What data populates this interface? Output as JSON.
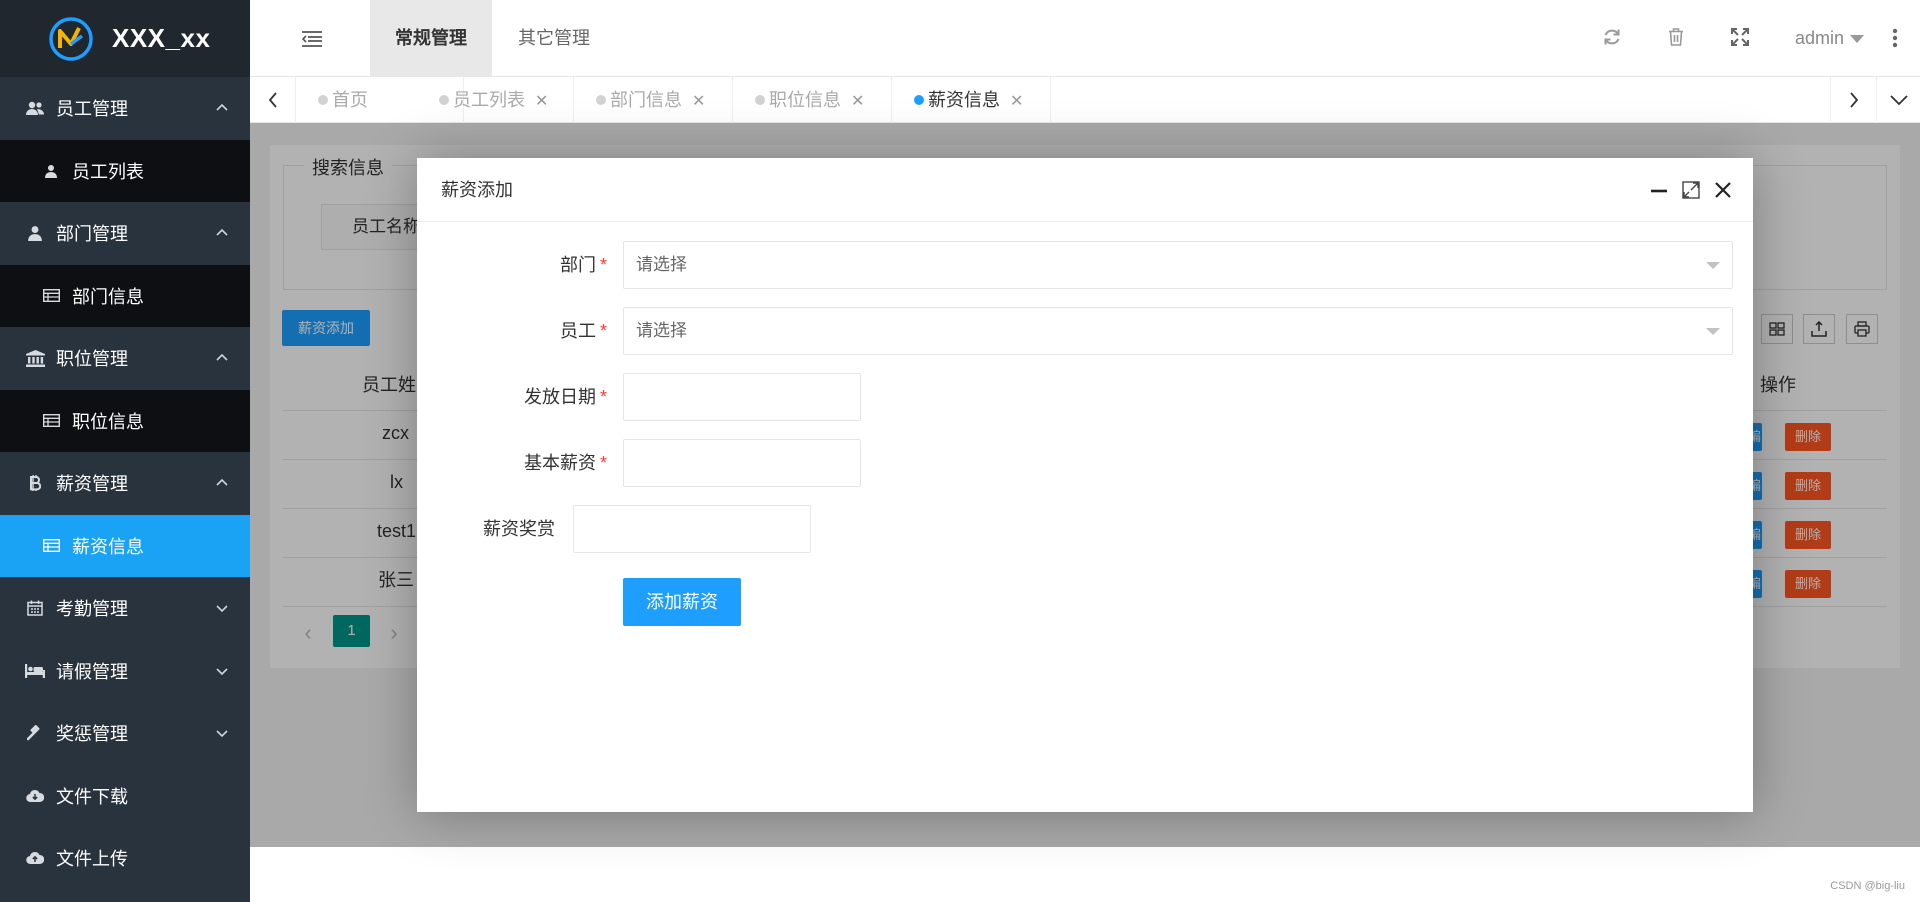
{
  "brand": {
    "title": "XXX_xx"
  },
  "sidebar": {
    "items": [
      {
        "label": "员工管理",
        "icon": "users-icon",
        "expanded": true,
        "children": [
          {
            "label": "员工列表",
            "icon": "user-icon"
          }
        ]
      },
      {
        "label": "部门管理",
        "icon": "user-icon",
        "expanded": true,
        "children": [
          {
            "label": "部门信息",
            "icon": "table-icon"
          }
        ]
      },
      {
        "label": "职位管理",
        "icon": "bank-icon",
        "expanded": true,
        "children": [
          {
            "label": "职位信息",
            "icon": "table-icon"
          }
        ]
      },
      {
        "label": "薪资管理",
        "icon": "bitcoin-icon",
        "expanded": true,
        "children": [
          {
            "label": "薪资信息",
            "icon": "table-icon",
            "active": true
          }
        ]
      },
      {
        "label": "考勤管理",
        "icon": "calendar-icon",
        "expanded": false
      },
      {
        "label": "请假管理",
        "icon": "bed-icon",
        "expanded": false
      },
      {
        "label": "奖惩管理",
        "icon": "gavel-icon",
        "expanded": false
      },
      {
        "label": "文件下载",
        "icon": "cloud-download-icon"
      },
      {
        "label": "文件上传",
        "icon": "cloud-upload-icon"
      }
    ]
  },
  "header": {
    "tabs": [
      {
        "label": "常规管理",
        "active": true
      },
      {
        "label": "其它管理",
        "active": false
      }
    ],
    "user": "admin"
  },
  "page_tabs": [
    {
      "label": "首页",
      "closable": false,
      "active": false
    },
    {
      "label": "员工列表",
      "closable": true,
      "active": false
    },
    {
      "label": "部门信息",
      "closable": true,
      "active": false
    },
    {
      "label": "职位信息",
      "closable": true,
      "active": false
    },
    {
      "label": "薪资信息",
      "closable": true,
      "active": true
    }
  ],
  "background_page": {
    "search_legend": "搜索信息",
    "search_label": "员工名称",
    "add_button": "薪资添加",
    "columns": {
      "name": "员工姓名",
      "actions": "操作"
    },
    "rows": [
      {
        "name": "zcx"
      },
      {
        "name": "lx"
      },
      {
        "name": "test1"
      },
      {
        "name": "张三"
      }
    ],
    "delete_label": "删除",
    "edit_label": "编辑",
    "current_page": "1"
  },
  "modal": {
    "title": "薪资添加",
    "fields": {
      "department": {
        "label": "部门",
        "required": true,
        "placeholder": "请选择"
      },
      "employee": {
        "label": "员工",
        "required": true,
        "placeholder": "请选择"
      },
      "date": {
        "label": "发放日期",
        "required": true,
        "value": ""
      },
      "base_salary": {
        "label": "基本薪资",
        "required": true,
        "value": ""
      },
      "bonus": {
        "label": "薪资奖赏",
        "required": false,
        "value": ""
      }
    },
    "submit_label": "添加薪资"
  },
  "watermark": "CSDN @big-liu",
  "colors": {
    "sidebar": "#28333e",
    "accent": "#1e9fff",
    "danger": "#ff5722",
    "pager": "#009688"
  }
}
